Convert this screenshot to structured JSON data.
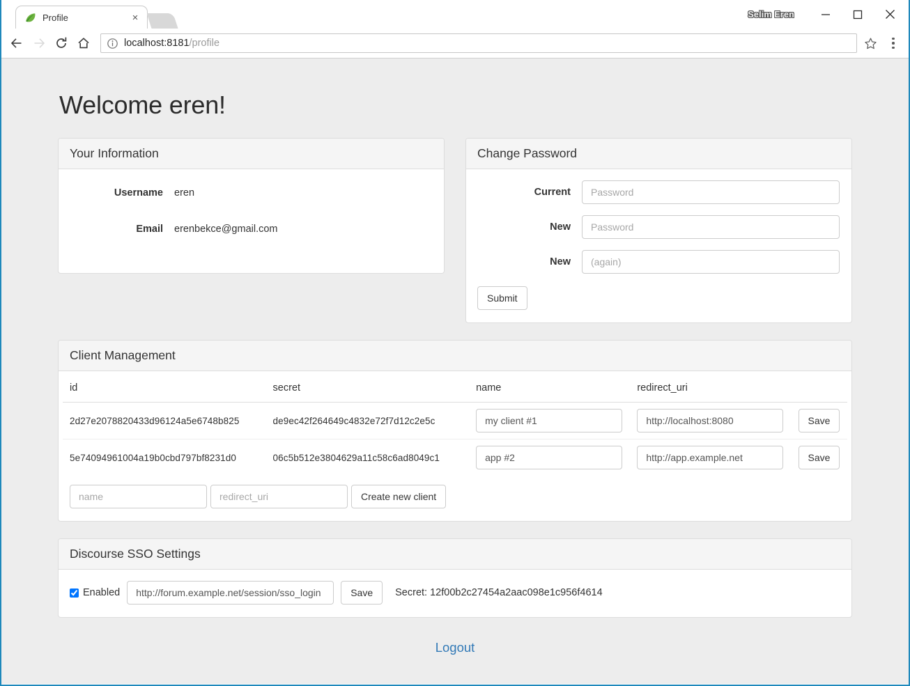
{
  "browser": {
    "tab": {
      "title": "Profile",
      "favicon": "spring-leaf-icon",
      "close": "×"
    },
    "new_tab_label": "",
    "window_user": "Selim Eren",
    "window_controls": {
      "minimize": "minimize-icon",
      "maximize": "maximize-icon",
      "close": "close-icon"
    },
    "nav": {
      "back": "back-arrow-icon",
      "forward": "forward-arrow-icon",
      "reload": "reload-icon",
      "home": "home-icon"
    },
    "omnibox": {
      "info_icon": "page-info-icon",
      "host": "localhost:8181",
      "path": "/profile",
      "star": "bookmark-star-icon",
      "menu": "three-dot-menu-icon"
    }
  },
  "page": {
    "heading": "Welcome eren!",
    "info_panel": {
      "title": "Your Information",
      "fields": [
        {
          "label": "Username",
          "value": "eren"
        },
        {
          "label": "Email",
          "value": "erenbekce@gmail.com"
        }
      ]
    },
    "password_panel": {
      "title": "Change Password",
      "fields": [
        {
          "label": "Current",
          "placeholder": "Password",
          "value": ""
        },
        {
          "label": "New",
          "placeholder": "Password",
          "value": ""
        },
        {
          "label": "New",
          "placeholder": "(again)",
          "value": ""
        }
      ],
      "submit_label": "Submit"
    },
    "client_panel": {
      "title": "Client Management",
      "columns": [
        "id",
        "secret",
        "name",
        "redirect_uri",
        ""
      ],
      "rows": [
        {
          "id": "2d27e2078820433d96124a5e6748b825",
          "secret": "de9ec42f264649c4832e72f7d12c2e5c",
          "name": "my client #1",
          "redirect_uri": "http://localhost:8080",
          "save_label": "Save"
        },
        {
          "id": "5e74094961004a19b0cbd797bf8231d0",
          "secret": "06c5b512e3804629a11c58c6ad8049c1",
          "name": "app #2",
          "redirect_uri": "http://app.example.net",
          "save_label": "Save"
        }
      ],
      "create": {
        "name_placeholder": "name",
        "name_value": "",
        "uri_placeholder": "redirect_uri",
        "uri_value": "",
        "button_label": "Create new client"
      }
    },
    "sso_panel": {
      "title": "Discourse SSO Settings",
      "enabled_label": "Enabled",
      "enabled": true,
      "url_value": "http://forum.example.net/session/sso_login",
      "url_placeholder": "",
      "save_label": "Save",
      "secret_text": "Secret: 12f00b2c27454a2aac098e1c956f4614"
    },
    "logout_label": "Logout"
  },
  "colors": {
    "window_border": "#1e88bb",
    "page_bg": "#ededed",
    "panel_border": "#dddddd",
    "panel_head_bg": "#f5f5f5",
    "link": "#337ab7",
    "favicon_green": "#6db33f"
  }
}
